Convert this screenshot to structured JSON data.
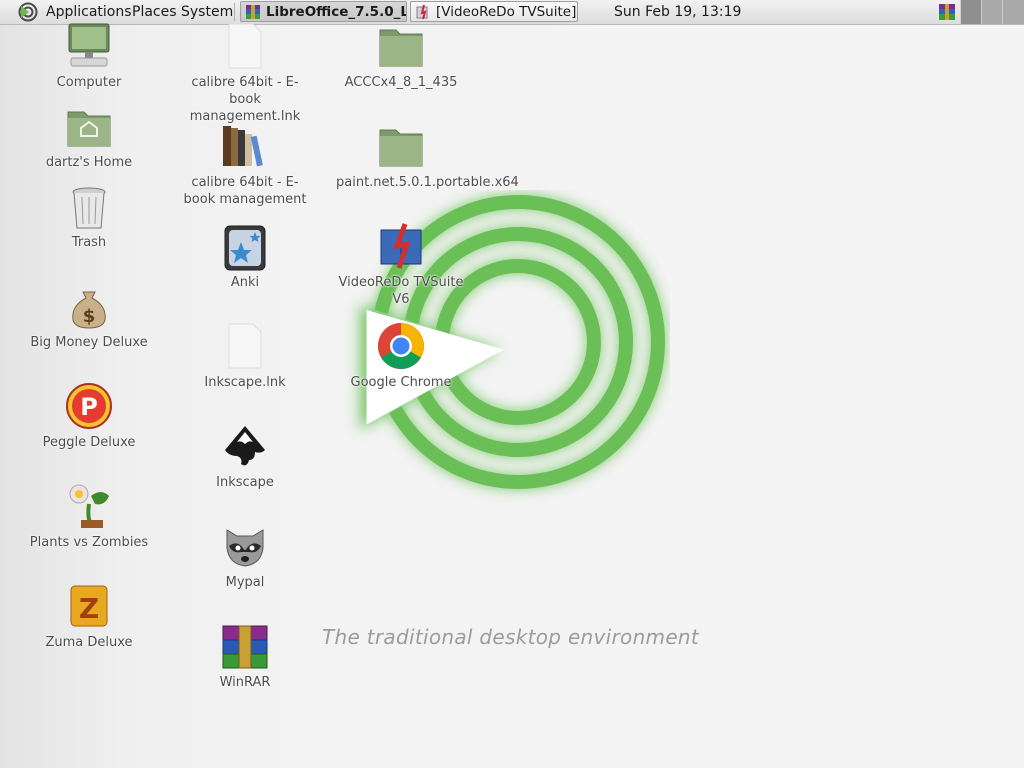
{
  "panel": {
    "menus": {
      "applications": "Applications",
      "places": "Places",
      "system": "System"
    },
    "tasks": [
      {
        "label": "LibreOffice_7.5.0_L...",
        "icon": "winrar-archive-icon",
        "active": true
      },
      {
        "label": "[VideoReDo TVSuite]",
        "icon": "videoredo-window-icon",
        "active": false
      }
    ],
    "clock": "Sun Feb 19, 13:19",
    "tray_icon": "winrar-tray-icon"
  },
  "wallpaper": {
    "tagline": "The traditional desktop environment",
    "logo": "mate-logo",
    "accent": "#6cc25a"
  },
  "desktop": {
    "icons": [
      {
        "id": "computer",
        "label": "Computer",
        "icon": "computer-icon"
      },
      {
        "id": "home",
        "label": "dartz's Home",
        "icon": "home-folder-icon"
      },
      {
        "id": "trash",
        "label": "Trash",
        "icon": "trash-icon"
      },
      {
        "id": "bigmoney",
        "label": "Big Money Deluxe",
        "icon": "money-bag-icon"
      },
      {
        "id": "peggle",
        "label": "Peggle Deluxe",
        "icon": "peggle-icon"
      },
      {
        "id": "pvz",
        "label": "Plants vs Zombies",
        "icon": "plants-vs-zombies-icon"
      },
      {
        "id": "zuma",
        "label": "Zuma Deluxe",
        "icon": "zuma-icon"
      },
      {
        "id": "calibre-lnk",
        "label": "calibre 64bit - E-book management.lnk",
        "icon": "file-icon"
      },
      {
        "id": "calibre",
        "label": "calibre 64bit - E-book management",
        "icon": "calibre-books-icon"
      },
      {
        "id": "anki",
        "label": "Anki",
        "icon": "anki-icon"
      },
      {
        "id": "inkscape-lnk",
        "label": "Inkscape.lnk",
        "icon": "file-icon"
      },
      {
        "id": "inkscape",
        "label": "Inkscape",
        "icon": "inkscape-icon"
      },
      {
        "id": "mypal",
        "label": "Mypal",
        "icon": "raccoon-icon"
      },
      {
        "id": "winrar",
        "label": "WinRAR",
        "icon": "winrar-icon"
      },
      {
        "id": "accc",
        "label": "ACCCx4_8_1_435",
        "icon": "folder-icon"
      },
      {
        "id": "paintnet",
        "label": "paint.net.5.0.1.portable.x64",
        "icon": "folder-icon"
      },
      {
        "id": "videoredo",
        "label": "VideoReDo TVSuite V6",
        "icon": "videoredo-icon"
      },
      {
        "id": "chrome",
        "label": "Google Chrome",
        "icon": "chrome-icon"
      }
    ]
  }
}
